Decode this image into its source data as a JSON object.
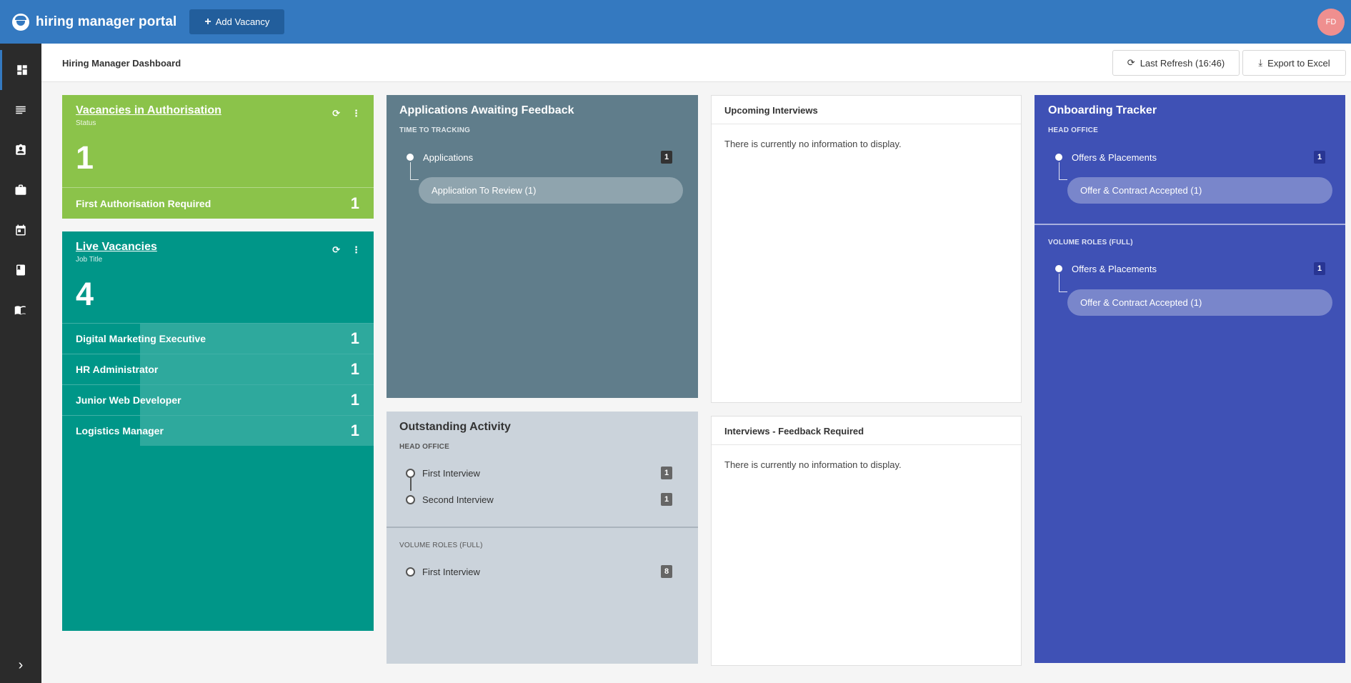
{
  "header": {
    "app_title": "hiring manager portal",
    "add_button": "Add Vacancy",
    "avatar_initials": "FD",
    "brand_color": "#3479c0"
  },
  "sidebar": {
    "items": [
      {
        "icon": "dashboard-icon"
      },
      {
        "icon": "list-icon"
      },
      {
        "icon": "clipboard-icon"
      },
      {
        "icon": "briefcase-icon"
      },
      {
        "icon": "calendar-icon"
      },
      {
        "icon": "book-icon"
      },
      {
        "icon": "open-book-icon"
      }
    ],
    "expand_icon": "chevron-right-icon"
  },
  "subheader": {
    "title": "Hiring Manager Dashboard",
    "refresh_button": "Last Refresh (16:46)",
    "export_button": "Export to Excel"
  },
  "auth_card": {
    "title": "Vacancies in Authorisation",
    "subtitle": "Status",
    "total": "1",
    "rows": [
      {
        "label": "First Authorisation Required",
        "count": "1"
      }
    ],
    "color": "#8bc34a"
  },
  "live_card": {
    "title": "Live Vacancies",
    "subtitle": "Job Title",
    "total": "4",
    "rows": [
      {
        "label": "Digital Marketing Executive",
        "count": "1"
      },
      {
        "label": "HR Administrator",
        "count": "1"
      },
      {
        "label": "Junior Web Developer",
        "count": "1"
      },
      {
        "label": "Logistics Manager",
        "count": "1"
      }
    ],
    "color": "#009688"
  },
  "apps_card": {
    "title": "Applications Awaiting Feedback",
    "section": "TIME TO TRACKING",
    "item_label": "Applications",
    "item_count": "1",
    "pill": "Application To Review (1)",
    "color": "#607d8b"
  },
  "outstanding_card": {
    "title": "Outstanding Activity",
    "section1": "HEAD OFFICE",
    "section1_items": [
      {
        "label": "First Interview",
        "count": "1"
      },
      {
        "label": "Second Interview",
        "count": "1"
      }
    ],
    "section2": "VOLUME ROLES (FULL)",
    "section2_items": [
      {
        "label": "First Interview",
        "count": "8"
      }
    ]
  },
  "upcoming_card": {
    "title": "Upcoming Interviews",
    "empty_text": "There is currently no information to display."
  },
  "feedback_card": {
    "title": "Interviews - Feedback Required",
    "empty_text": "There is currently no information to display."
  },
  "onboarding_card": {
    "title": "Onboarding Tracker",
    "section1": "HEAD OFFICE",
    "section1_item": "Offers & Placements",
    "section1_count": "1",
    "section1_pill": "Offer & Contract Accepted (1)",
    "section2": "VOLUME ROLES (FULL)",
    "section2_item": "Offers & Placements",
    "section2_count": "1",
    "section2_pill": "Offer & Contract Accepted (1)",
    "color": "#3f51b5"
  }
}
